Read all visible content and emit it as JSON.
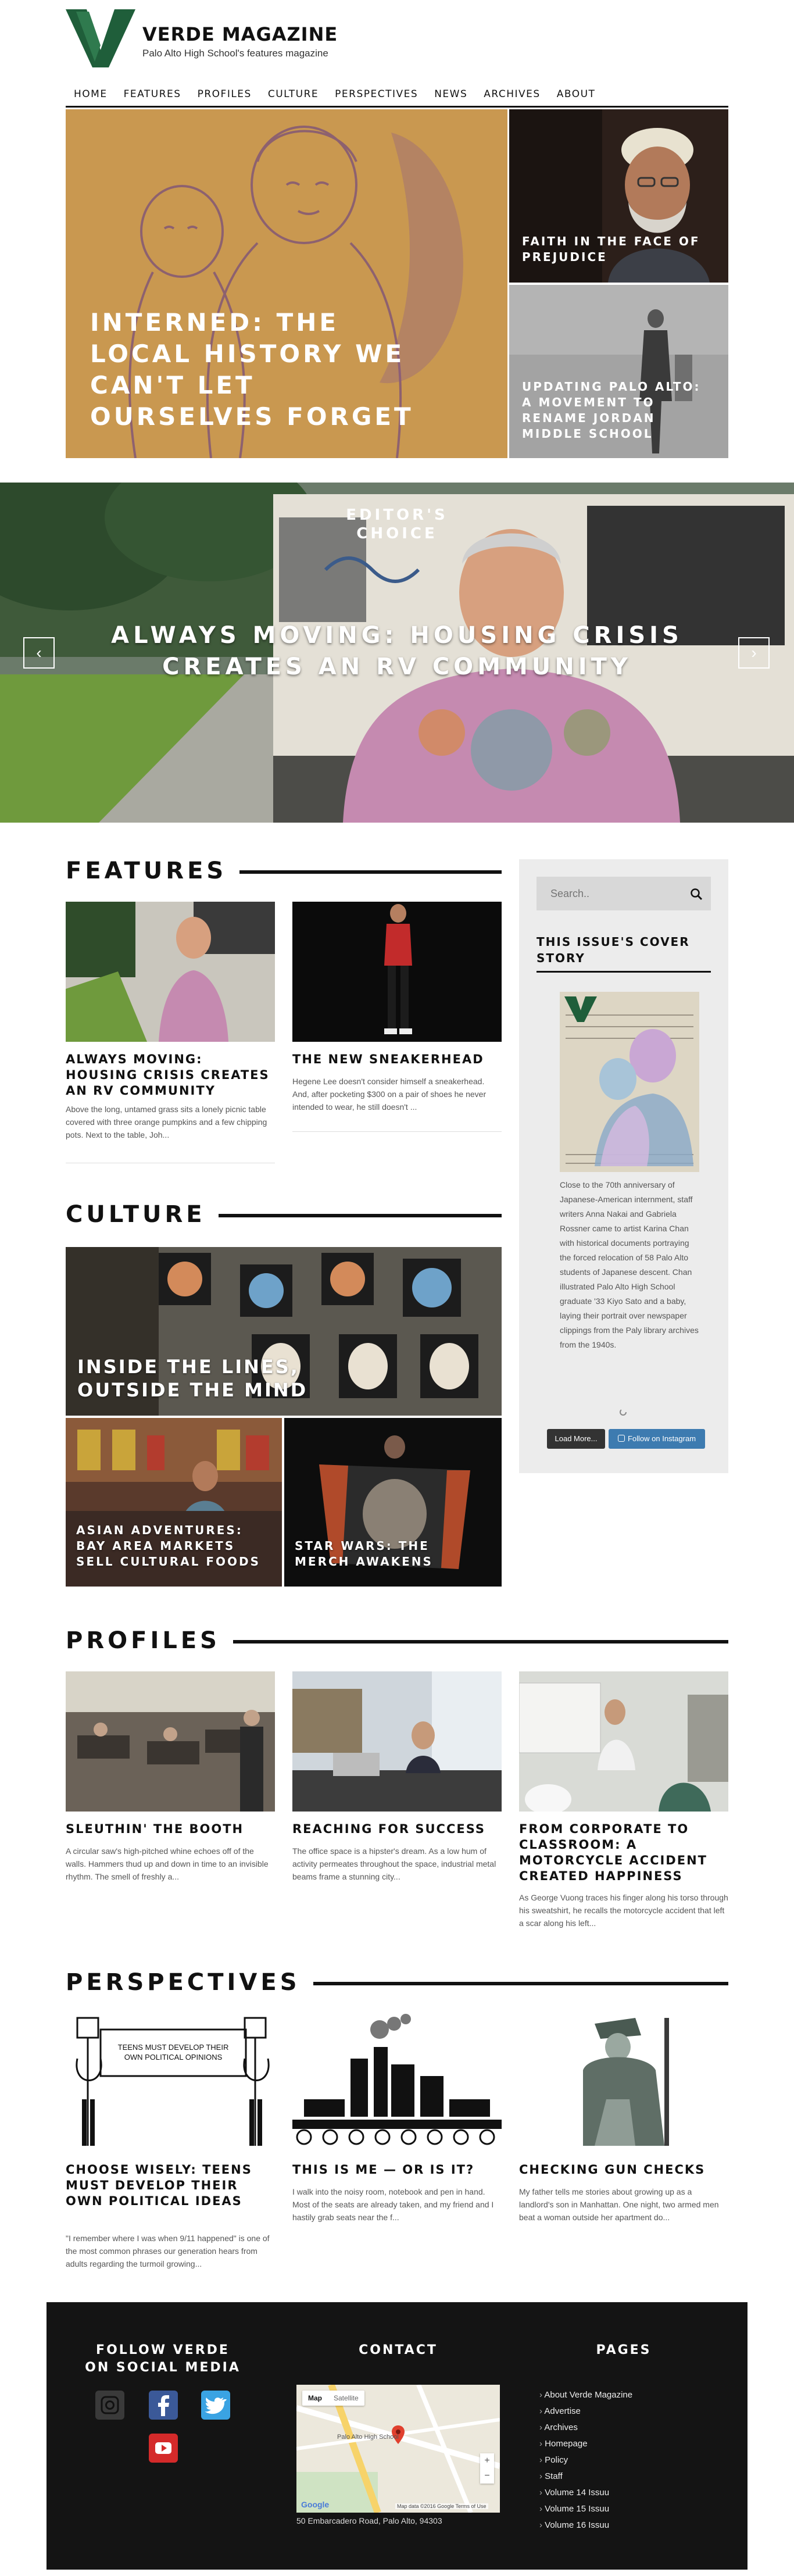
{
  "site": {
    "name": "VERDE MAGAZINE",
    "tagline": "Palo Alto High School's features magazine",
    "brand_color": "#1f5e3a"
  },
  "nav": [
    "HOME",
    "FEATURES",
    "PROFILES",
    "CULTURE",
    "PERSPECTIVES",
    "NEWS",
    "ARCHIVES",
    "ABOUT"
  ],
  "top_stories": {
    "main": "INTERNED: THE LOCAL HISTORY WE CAN'T LET OURSELVES FORGET",
    "right_top": "FAITH IN THE FACE OF PREJUDICE",
    "right_bottom": "UPDATING PALO ALTO: A MOVEMENT TO RENAME JORDAN MIDDLE SCHOOL"
  },
  "slider": {
    "label": "EDITOR'S CHOICE",
    "headline": "ALWAYS MOVING: HOUSING CRISIS CREATES AN RV COMMUNITY",
    "prev_icon": "chevron-left-icon",
    "next_icon": "chevron-right-icon"
  },
  "features": {
    "heading": "FEATURES",
    "items": [
      {
        "title": "ALWAYS MOVING: HOUSING CRISIS CREATES AN RV COMMUNITY",
        "excerpt": "Above the long, untamed grass sits a lonely picnic table covered with three orange pumpkins and a few chipping pots.  Next to the table, Joh..."
      },
      {
        "title": "THE NEW SNEAKERHEAD",
        "excerpt": "Hegene Lee doesn't consider himself a sneakerhead. And, after pocketing $300 on a pair of shoes he never intended to wear, he still doesn't ..."
      }
    ]
  },
  "sidebar": {
    "search_placeholder": "Search..",
    "cover_heading": "THIS ISSUE'S COVER STORY",
    "cover_text": "Close to the 70th anniversary of Japanese-American internment, staff writers Anna Nakai and Gabriela Rossner came to artist Karina Chan with historical documents portraying the forced relocation of 58 Palo Alto students of Japanese descent. Chan illustrated Palo Alto High School graduate '33 Kiyo Sato and a baby, laying their portrait over newspaper clippings from the Paly library archives from the 1940s.",
    "load_more": "Load More...",
    "follow": "Follow on Instagram"
  },
  "culture": {
    "heading": "CULTURE",
    "items": [
      "INSIDE THE LINES, OUTSIDE THE MIND",
      "ASIAN ADVENTURES: BAY AREA MARKETS SELL CULTURAL FOODS",
      "STAR WARS: THE MERCH AWAKENS"
    ]
  },
  "profiles": {
    "heading": "PROFILES",
    "items": [
      {
        "title": "SLEUTHIN' THE BOOTH",
        "excerpt": "A circular saw's high-pitched whine echoes off of the walls. Hammers thud up and down in time to an invisible rhythm. The smell of freshly a..."
      },
      {
        "title": "REACHING FOR SUCCESS",
        "excerpt": "The office space is a hipster's dream. As a low hum of activity permeates throughout the space, industrial metal beams frame a stunning city..."
      },
      {
        "title": "FROM CORPORATE TO CLASSROOM: A MOTORCYCLE ACCIDENT CREATED HAPPINESS",
        "excerpt": "As George Vuong traces his finger along his torso through his sweatshirt, he recalls the motorcycle accident that left a scar along his left..."
      }
    ]
  },
  "perspectives": {
    "heading": "PERSPECTIVES",
    "sign_text": "TEENS MUST DEVELOP THEIR OWN POLITICAL OPINIONS",
    "items": [
      {
        "title": "CHOOSE WISELY: TEENS MUST DEVELOP THEIR OWN POLITICAL IDEAS",
        "excerpt": "\"I remember where I was when 9/11 happened\" is one of the most common phrases our generation hears from adults regarding the turmoil growing..."
      },
      {
        "title": "THIS IS ME — OR IS IT?",
        "excerpt": "I walk into the noisy room, notebook and pen in hand. Most of the seats are already taken, and my friend and I hastily grab seats near the f..."
      },
      {
        "title": "CHECKING GUN CHECKS",
        "excerpt": "My father tells me stories about growing up as a landlord's son in Manhattan. One night, two armed men beat a woman outside her apartment do..."
      }
    ]
  },
  "footer": {
    "social_heading": "FOLLOW VERDE ON SOCIAL MEDIA",
    "contact_heading": "CONTACT",
    "pages_heading": "PAGES",
    "social_icons": [
      "instagram-icon",
      "facebook-icon",
      "twitter-icon",
      "youtube-icon"
    ],
    "map": {
      "tab_map": "Map",
      "tab_satellite": "Satellite",
      "marker_label": "Palo Alto High School",
      "google": "Google",
      "credits": "Map data ©2016 Google   Terms of Use"
    },
    "address": "50 Embarcadero Road, Palo Alto, 94303",
    "pages": [
      "About Verde Magazine",
      "Advertise",
      "Archives",
      "Homepage",
      "Policy",
      "Staff",
      "Volume 14 Issuu",
      "Volume 15 Issuu",
      "Volume 16 Issuu"
    ]
  }
}
